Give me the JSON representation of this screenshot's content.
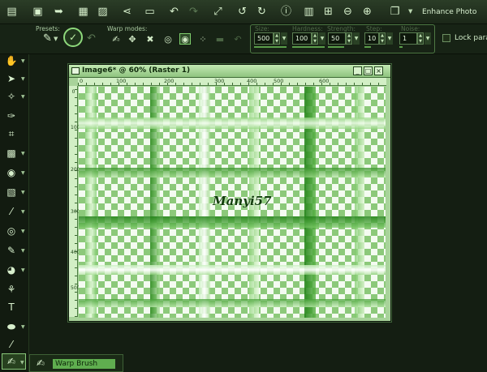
{
  "toolbar": {
    "icons": [
      "new-icon",
      "open-icon",
      "revert-icon",
      "save-icon",
      "save-as-icon",
      "share-icon",
      "print-icon",
      "undo-icon",
      "redo-icon",
      "resize-icon",
      "rotate-left-icon",
      "rotate-right-icon",
      "info-icon",
      "histogram-icon",
      "zoom-out-icon",
      "zoom-in-icon",
      "copy-icon"
    ],
    "enhance_label": "Enhance Photo"
  },
  "options": {
    "presets_label": "Presets:",
    "warp_modes_label": "Warp modes:",
    "size_label": "Size:",
    "hardness_label": "Hardness:",
    "strength_label": "Strength:",
    "steps_label": "Step:",
    "noise_label": "Noise:",
    "size_value": "500",
    "hardness_value": "100",
    "strength_value": "50",
    "steps_value": "10",
    "noise_value": "1",
    "lock_label": "Lock para"
  },
  "document": {
    "title": "Image6* @  60% (Raster 1)",
    "ruler_top": [
      "0",
      "100",
      "200",
      "300",
      "400",
      "500",
      "600"
    ],
    "ruler_left": [
      "0",
      "100",
      "200",
      "300",
      "400",
      "500"
    ],
    "watermark": "Manyi57"
  },
  "status": {
    "tool_name": "Warp Brush"
  },
  "colors": {
    "accent": "#7fcf6d",
    "grid_dark": "#2f8a22",
    "grid_light": "#b6e6a6"
  }
}
